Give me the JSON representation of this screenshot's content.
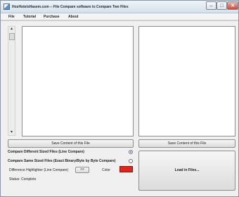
{
  "window": {
    "title": "HosHotelsHasem.com -- File Compare software to Compare Two Files",
    "controls": {
      "minimize": "–",
      "maximize": "□",
      "close": "✕"
    }
  },
  "menu": {
    "items": [
      "File",
      "Tutorial",
      "Purchase",
      "About"
    ]
  },
  "scrollbar": {
    "up": "▴",
    "down": "▾"
  },
  "panes": {
    "left_save_label": "Save Content of this File",
    "right_save_label": "Save Content of this File"
  },
  "options": {
    "compare_different_sized": "Compare Different Sized Files (Line Compare)",
    "compare_same_sized": "Compare Same Sized Files (Exact Binary/Byte by Byte Compare)",
    "selected": "compare_different_sized"
  },
  "highlighter": {
    "label": "Difference Highlighter (Line Compare)",
    "button": ">>",
    "color_label": "Color",
    "color": "#e8221a"
  },
  "status": {
    "text": "Status: Complete"
  },
  "load_button": {
    "label": "Load in Files..."
  }
}
